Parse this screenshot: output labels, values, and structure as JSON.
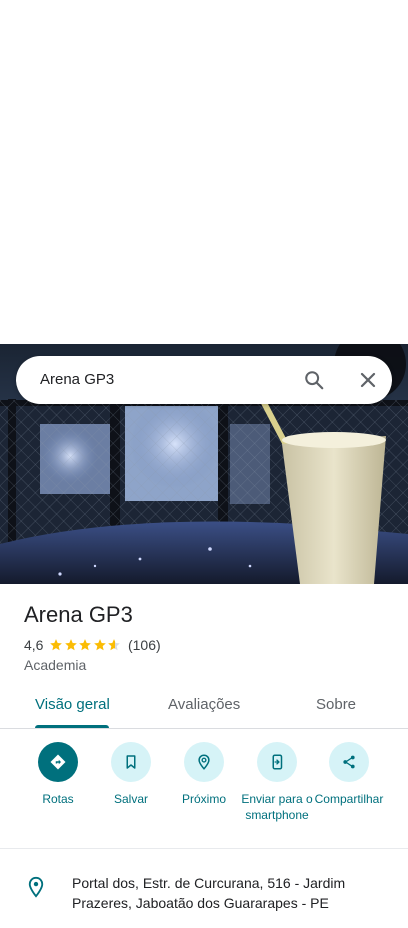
{
  "search": {
    "query": "Arena GP3"
  },
  "place": {
    "name": "Arena GP3",
    "rating": "4,6",
    "rating_value": 4.6,
    "review_count": "(106)",
    "category": "Academia"
  },
  "tabs": [
    {
      "label": "Visão geral",
      "active": true
    },
    {
      "label": "Avaliações",
      "active": false
    },
    {
      "label": "Sobre",
      "active": false
    }
  ],
  "actions": [
    {
      "label": "Rotas",
      "icon": "directions-icon"
    },
    {
      "label": "Salvar",
      "icon": "bookmark-icon"
    },
    {
      "label": "Próximo",
      "icon": "nearby-icon"
    },
    {
      "label": "Enviar para o smartphone",
      "icon": "send-to-phone-icon"
    },
    {
      "label": "Compartilhar",
      "icon": "share-icon"
    }
  ],
  "address": {
    "text": "Portal dos, Estr. de Curcurana, 516 - Jardim Prazeres, Jaboatão dos Guararapes - PE"
  },
  "colors": {
    "accent": "#00707d",
    "accent_light": "#d6f3f7",
    "star": "#fbbc04"
  }
}
